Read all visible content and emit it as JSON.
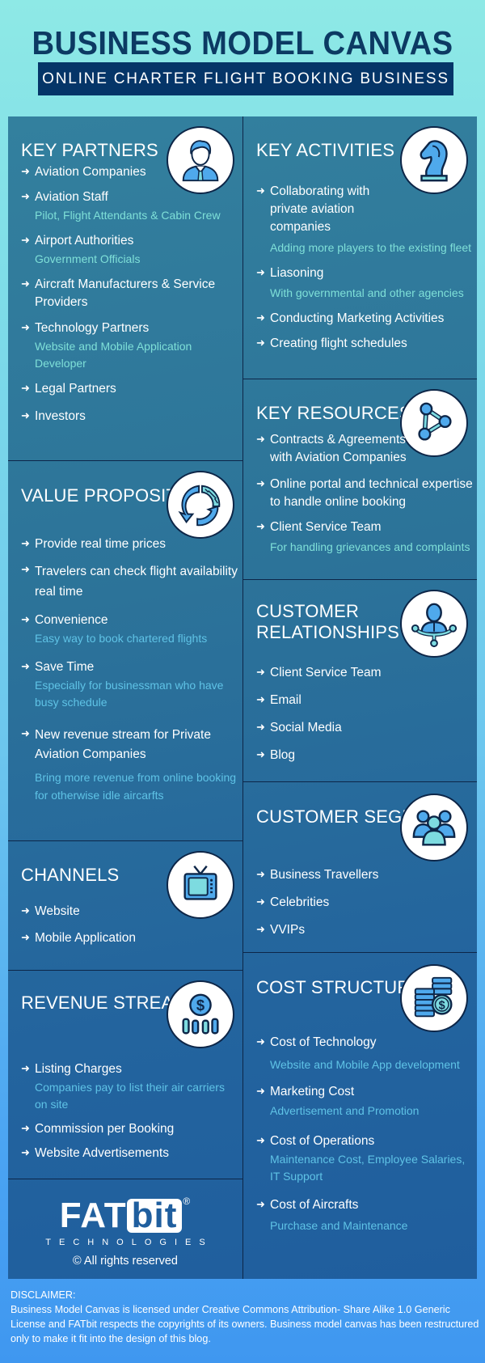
{
  "header": {
    "title": "BUSINESS MODEL CANVAS",
    "subtitle": "ONLINE CHARTER FLIGHT BOOKING BUSINESS"
  },
  "colors": {
    "title": "#0c3a63",
    "subtitle_bg": "#053568",
    "panel": "#2c7399",
    "divider": "#0d2648",
    "sub_text_teal": "#7fe0d8",
    "sub_text_blue": "#5fc3e6",
    "icon_blue": "#4fa9ec",
    "icon_teal": "#7ddbe0"
  },
  "arrow_glyph": "➜",
  "blocks": {
    "key_partners": {
      "title": "KEY PARTNERS",
      "icon": "businessman-icon",
      "items": [
        {
          "label": "Aviation Companies"
        },
        {
          "label": "Aviation Staff",
          "sub": "Pilot, Flight Attendants & Cabin Crew"
        },
        {
          "label": "Airport Authorities",
          "sub": "Government Officials"
        },
        {
          "label": "Aircraft Manufacturers & Service Providers"
        },
        {
          "label": "Technology Partners",
          "sub": "Website and Mobile Application Developer"
        },
        {
          "label": "Legal Partners"
        },
        {
          "label": "Investors"
        }
      ]
    },
    "key_activities": {
      "title": "KEY ACTIVITIES",
      "icon": "chess-knight-icon",
      "items": [
        {
          "label": "Collaborating with private aviation companies",
          "sub": "Adding more players to the existing fleet"
        },
        {
          "label": "Liasoning",
          "sub": "With governmental and other agencies"
        },
        {
          "label": "Conducting Marketing Activities"
        },
        {
          "label": "Creating flight schedules"
        }
      ]
    },
    "key_resources": {
      "title": "KEY RESOURCES",
      "icon": "network-nodes-icon",
      "items": [
        {
          "label": "Contracts & Agreements with Aviation Companies"
        },
        {
          "label": "Online portal and technical expertise to handle online booking"
        },
        {
          "label": "Client Service Team",
          "sub": "For handling grievances and complaints"
        }
      ]
    },
    "value_proposition": {
      "title": "VALUE PROPOSITION",
      "icon": "cycle-arrows-icon",
      "items": [
        {
          "label": "Provide real time prices"
        },
        {
          "label": "Travelers can check flight availability real time"
        },
        {
          "label": "Convenience",
          "sub": "Easy way to book chartered flights"
        },
        {
          "label": "Save Time",
          "sub": "Especially for businessman who have busy schedule"
        },
        {
          "label": "New revenue stream for Private Aviation Companies",
          "sub": "Bring more revenue from online booking for otherwise idle aircarfts"
        }
      ]
    },
    "customer_relationships": {
      "title": "CUSTOMER RELATIONSHIPS",
      "icon": "connected-person-icon",
      "items": [
        {
          "label": "Client Service Team"
        },
        {
          "label": "Email"
        },
        {
          "label": "Social Media"
        },
        {
          "label": "Blog"
        }
      ]
    },
    "channels": {
      "title": "CHANNELS",
      "icon": "tv-icon",
      "items": [
        {
          "label": "Website"
        },
        {
          "label": "Mobile Application"
        }
      ]
    },
    "customer_segments": {
      "title": "CUSTOMER SEGMENTS",
      "icon": "user-group-icon",
      "items": [
        {
          "label": "Business Travellers"
        },
        {
          "label": "Celebrities"
        },
        {
          "label": "VVIPs"
        }
      ]
    },
    "revenue_streams": {
      "title": "REVENUE STREAMS",
      "icon": "dollar-bars-icon",
      "items": [
        {
          "label": "Listing Charges",
          "sub": "Companies pay to list their air carriers on site"
        },
        {
          "label": "Commission per Booking"
        },
        {
          "label": "Website Advertisements"
        }
      ]
    },
    "cost_structure": {
      "title": "COST STRUCTURE",
      "icon": "coin-stacks-icon",
      "items": [
        {
          "label": "Cost of Technology",
          "sub": "Website and Mobile App development"
        },
        {
          "label": "Marketing Cost",
          "sub": "Advertisement and Promotion"
        },
        {
          "label": "Cost of Operations",
          "sub": "Maintenance Cost, Employee Salaries, IT Support"
        },
        {
          "label": "Cost of Aircrafts",
          "sub": "Purchase and Maintenance"
        }
      ]
    }
  },
  "logo": {
    "brand_main": "FAT",
    "brand_box": "bit",
    "registered": "®",
    "tagline": "TECHNOLOGIES",
    "rights": "© All rights reserved"
  },
  "disclaimer": {
    "heading": "DISCLAIMER:",
    "text": "Business Model Canvas is licensed under Creative Commons Attribution- Share Alike 1.0 Generic License and FATbit respects the copyrights of its owners. Business model canvas has been restructured only to make it fit into the design of this blog."
  }
}
